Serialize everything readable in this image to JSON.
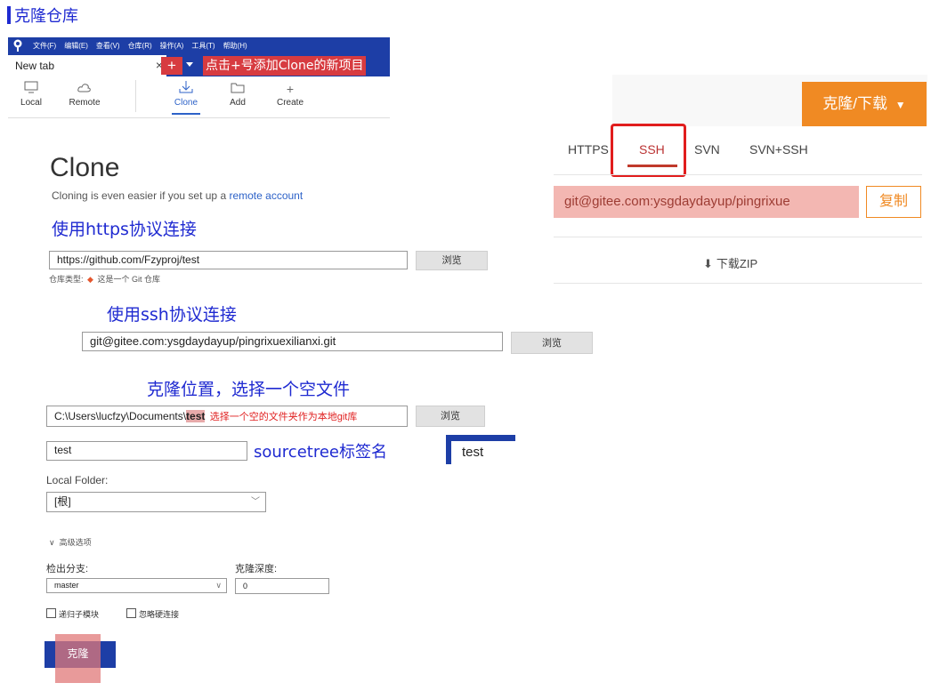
{
  "heading": "克隆仓库",
  "menubar": [
    "文件(F)",
    "编辑(E)",
    "查看(V)",
    "仓库(R)",
    "操作(A)",
    "工具(T)",
    "帮助(H)"
  ],
  "tab": {
    "label": "New tab",
    "close": "×",
    "plus": "+"
  },
  "annotation_add": "点击+号添加Clone的新项目",
  "toolbar": {
    "local": "Local",
    "remote": "Remote",
    "clone": "Clone",
    "add": "Add",
    "create": "Create"
  },
  "clone": {
    "title": "Clone",
    "subtitle": "Cloning is even easier if you set up a",
    "subtitle_link": "remote account"
  },
  "https_label": "使用https协议连接",
  "https_url": "https://github.com/Fzyproj/test",
  "browse": "浏览",
  "repo_type_label": "仓库类型:",
  "repo_type_value": "这是一个 Git 仓库",
  "ssh_label": "使用ssh协议连接",
  "ssh_url": "git@gitee.com:ysgdaydayup/pingrixuexilianxi.git",
  "location_label": "克隆位置，选择一个空文件",
  "path_prefix": "C:\\Users\\lucfzy\\Documents\\",
  "path_highlight": "test",
  "path_note": "选择一个空的文件夹作为本地git库",
  "name_value": "test",
  "name_label": "sourcetree标签名",
  "tab_preview": "test",
  "local_folder_label": "Local Folder:",
  "local_folder_value": "[根]",
  "advanced": "高级选项",
  "checkout_branch_label": "检出分支:",
  "checkout_branch_value": "master",
  "depth_label": "克隆深度:",
  "depth_value": "0",
  "recursive": "递归子模块",
  "ignore_hardlinks": "忽略硬连接",
  "clone_button": "克隆",
  "gitee": {
    "clone_download": "克隆/下载",
    "tabs": [
      "HTTPS",
      "SSH",
      "SVN",
      "SVN+SSH"
    ],
    "url": "git@gitee.com:ysgdaydayup/pingrixue",
    "copy": "复制",
    "download_zip": "下载ZIP"
  },
  "colors": {
    "accent": "#1d3ea6",
    "red": "#d73b40",
    "gitee_orange": "#f08a23",
    "label_blue": "#1f2ad1"
  }
}
